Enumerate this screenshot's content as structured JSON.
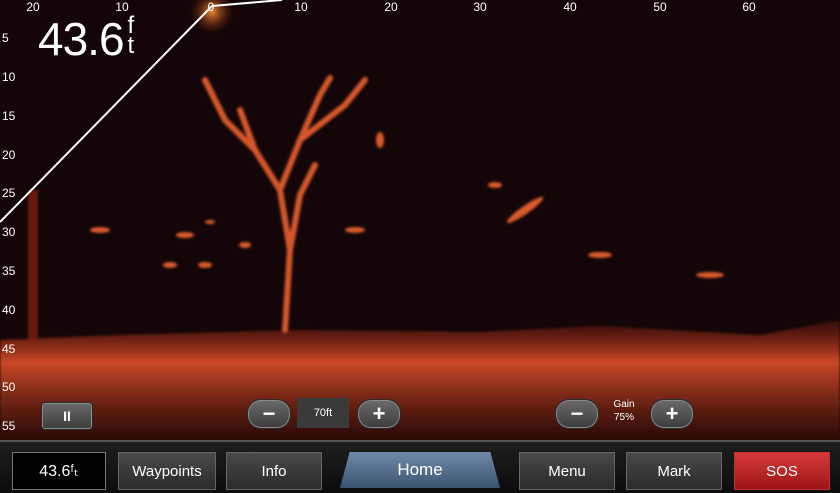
{
  "top_axis": [
    "20",
    "10",
    "0",
    "10",
    "20",
    "30",
    "40",
    "50",
    "60"
  ],
  "left_axis": [
    "5",
    "10",
    "15",
    "20",
    "25",
    "30",
    "35",
    "40",
    "45",
    "50",
    "55"
  ],
  "depth": {
    "value": "43.6",
    "unit_top": "f",
    "unit_bottom": "t"
  },
  "controls": {
    "pause_label": "II",
    "zoom_minus": "−",
    "zoom_plus": "+",
    "scale_value": "70ft",
    "gain_minus": "−",
    "gain_plus": "+",
    "gain_label": "Gain",
    "gain_value": "75%"
  },
  "bottom_bar": {
    "depth_readout": "43.6ᶠₜ",
    "waypoints": "Waypoints",
    "info": "Info",
    "home": "Home",
    "menu": "Menu",
    "mark": "Mark",
    "sos": "SOS"
  },
  "colors": {
    "accent": "#c24a1c",
    "sos": "#c62828",
    "home": "#4e6a8c"
  }
}
